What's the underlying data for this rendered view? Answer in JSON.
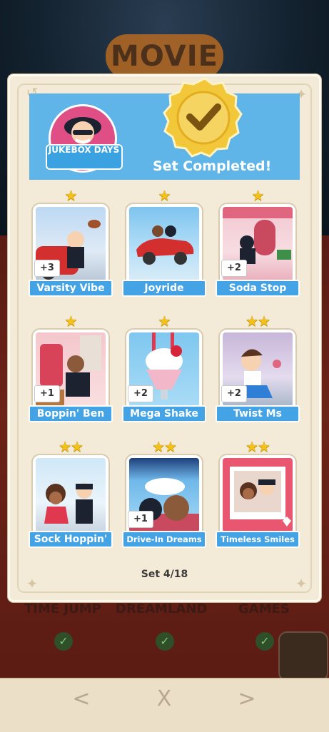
{
  "background": {
    "logo_text": "MOVIE",
    "bottom_labels": [
      "TIME JUMP",
      "DREAMLAND",
      "GAMES"
    ]
  },
  "dialog": {
    "album_name": "JUKEBOX DAYS",
    "status": "Set Completed!",
    "set_counter": "Set 4/18"
  },
  "stickers": [
    {
      "name": "Varsity Vibe",
      "stars": 1,
      "duplicates": "+3"
    },
    {
      "name": "Joyride",
      "stars": 1,
      "duplicates": ""
    },
    {
      "name": "Soda Stop",
      "stars": 1,
      "duplicates": "+2"
    },
    {
      "name": "Boppin' Ben",
      "stars": 1,
      "duplicates": "+1"
    },
    {
      "name": "Mega Shake",
      "stars": 1,
      "duplicates": "+2"
    },
    {
      "name": "Twist Ms",
      "stars": 2,
      "duplicates": "+2"
    },
    {
      "name": "Sock Hoppin'",
      "stars": 2,
      "duplicates": ""
    },
    {
      "name": "Drive-In Dreams",
      "stars": 2,
      "duplicates": "+1"
    },
    {
      "name": "Timeless Smiles",
      "stars": 2,
      "duplicates": ""
    }
  ],
  "nav": {
    "prev": "<",
    "close": "X",
    "next": ">"
  },
  "colors": {
    "header_blue": "#5fb4e8",
    "label_blue": "#43a3e5",
    "star_gold": "#f4c11a",
    "medal_gold": "#f2c83a"
  }
}
